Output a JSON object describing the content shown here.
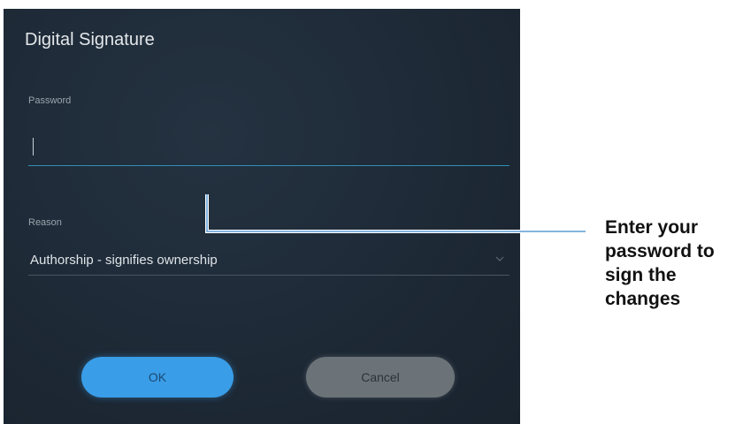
{
  "dialog": {
    "title": "Digital Signature",
    "password": {
      "label": "Password",
      "value": "",
      "placeholder": ""
    },
    "reason": {
      "label": "Reason",
      "selected": "Authorship - signifies ownership"
    },
    "buttons": {
      "ok_label": "OK",
      "cancel_label": "Cancel"
    }
  },
  "callout": {
    "text": "Enter your password to sign the changes"
  },
  "colors": {
    "dialog_bg": "#1e2a36",
    "accent": "#3a9de8",
    "input_underline": "#2f8fb5",
    "cancel_bg": "#6c7378",
    "leader_line": "#5b9bd5"
  },
  "icons": {
    "dropdown": "chevron-down-icon"
  }
}
